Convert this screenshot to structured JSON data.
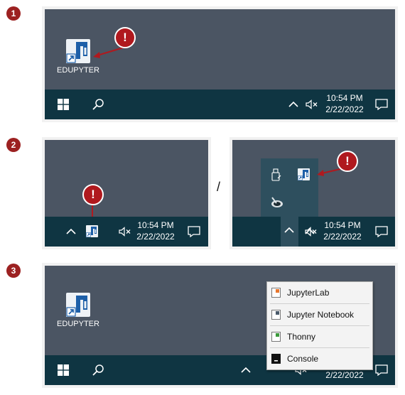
{
  "steps": {
    "s1": "1",
    "s2": "2",
    "s3": "3"
  },
  "warning_symbol": "!",
  "separator": "/",
  "desktop_icon": {
    "label": "EDUPYTER"
  },
  "clock": {
    "time": "10:54 PM",
    "date": "2/22/2022"
  },
  "context_menu": {
    "items": [
      {
        "label": "JupyterLab",
        "icon": "jupyterlab-icon",
        "color": "#e8772e"
      },
      {
        "label": "Jupyter Notebook",
        "icon": "jupyter-notebook-icon",
        "color": "#4a5a6a"
      },
      {
        "label": "Thonny",
        "icon": "thonny-icon",
        "color": "#3c9a3c"
      },
      {
        "label": "Console",
        "icon": "console-icon",
        "color": "#111111"
      }
    ]
  },
  "colors": {
    "desktop": "#4b5563",
    "taskbar": "#0f3542",
    "step_badge": "#9c2121",
    "warning": "#b0191e",
    "tray_flyout": "#2e4f5e"
  }
}
